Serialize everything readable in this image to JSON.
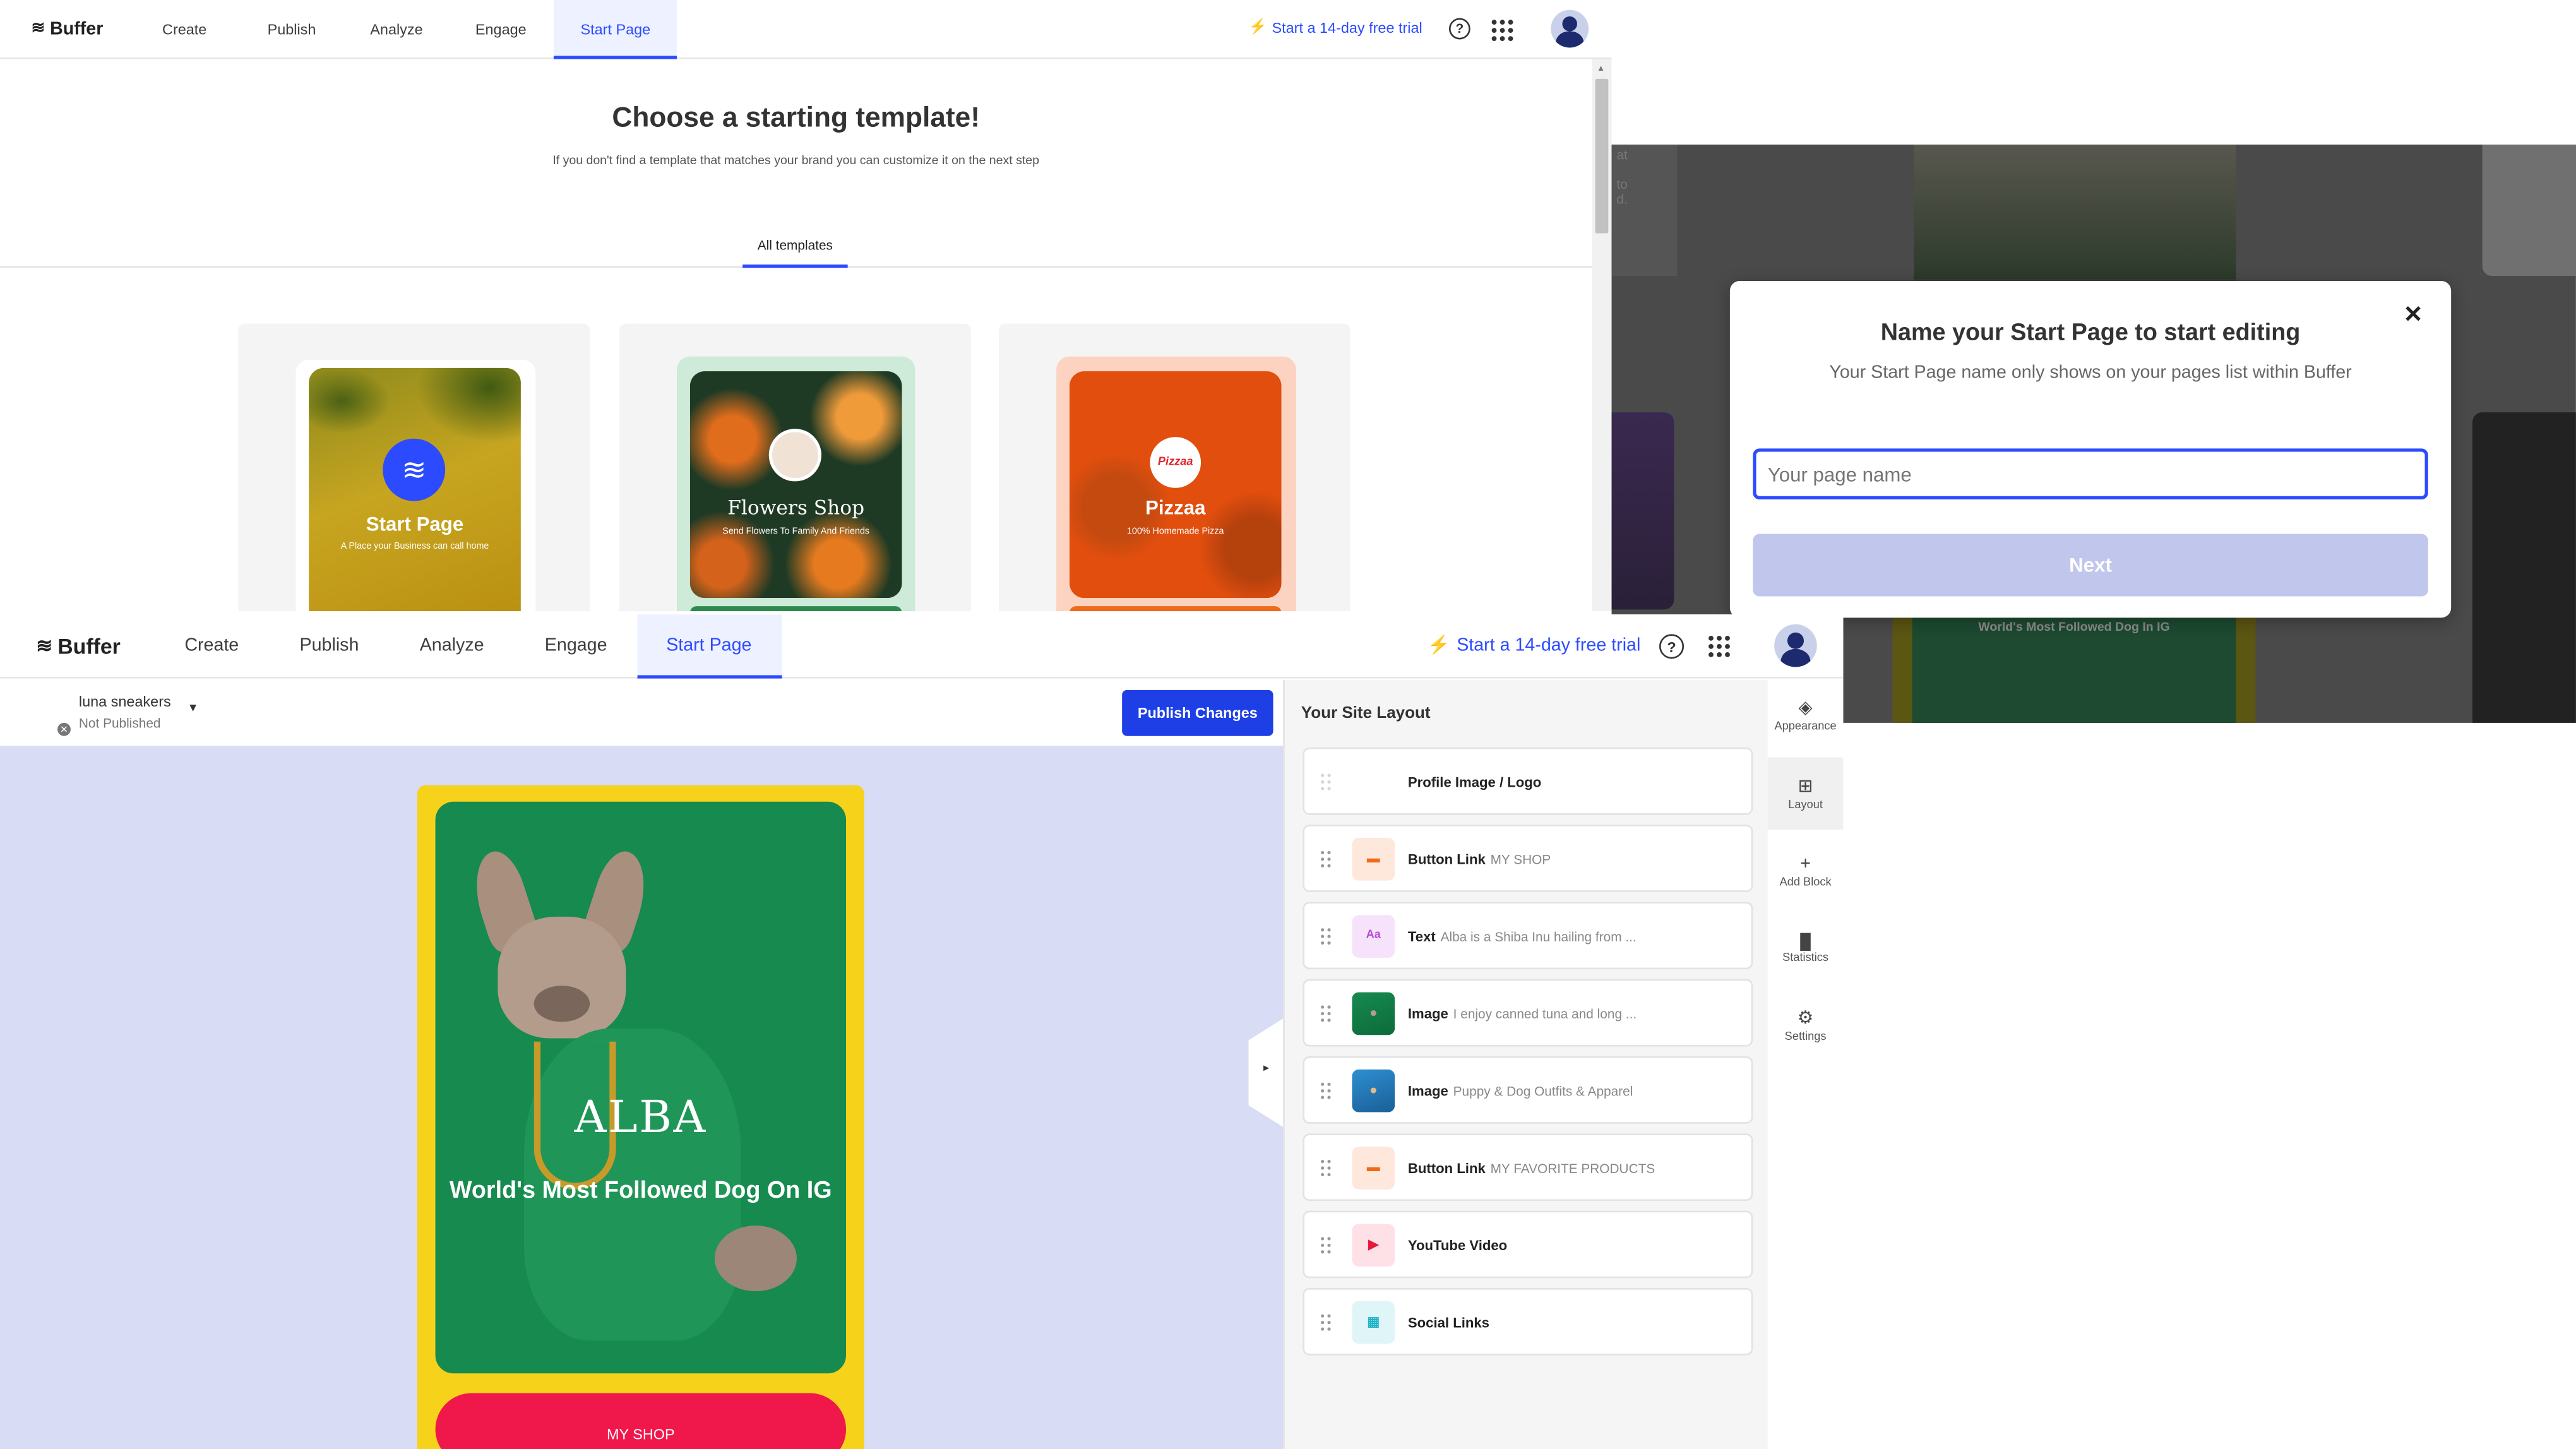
{
  "template_picker": {
    "nav": {
      "logo": "Buffer",
      "tabs": [
        "Create",
        "Publish",
        "Analyze",
        "Engage",
        "Start Page"
      ],
      "trial": "Start a 14-day free trial"
    },
    "title": "Choose a starting template!",
    "subtitle": "If you don't find a template that matches your brand you can customize it on the next step",
    "filter_tab": "All templates",
    "templates": [
      {
        "name": "Start Page",
        "tagline": "A Place your Business can call home"
      },
      {
        "name": "Flowers Shop",
        "tagline": "Send Flowers To Family And Friends"
      },
      {
        "name": "Pizzaa",
        "tagline": "100% Homemade Pizza",
        "badge": "Pizzaa"
      }
    ]
  },
  "editor": {
    "nav": {
      "logo": "Buffer",
      "tabs": [
        "Create",
        "Publish",
        "Analyze",
        "Engage",
        "Start Page"
      ],
      "trial": "Start a 14-day free trial"
    },
    "page_name": "luna sneakers",
    "page_status": "Not Published",
    "publish_button": "Publish Changes",
    "preview": {
      "name": "ALBA",
      "headline": "World's Most Followed Dog On IG",
      "button": "MY SHOP"
    },
    "layout_title": "Your Site Layout",
    "layout_items": [
      {
        "label": "Profile Image / Logo",
        "sub": ""
      },
      {
        "label": "Button Link",
        "sub": "MY SHOP"
      },
      {
        "label": "Text",
        "sub": "Alba is a Shiba Inu hailing from ..."
      },
      {
        "label": "Image",
        "sub": "I enjoy canned tuna and long ..."
      },
      {
        "label": "Image",
        "sub": "Puppy & Dog Outfits & Apparel"
      },
      {
        "label": "Button Link",
        "sub": "MY FAVORITE PRODUCTS"
      },
      {
        "label": "YouTube Video",
        "sub": ""
      },
      {
        "label": "Social Links",
        "sub": ""
      }
    ],
    "rail": [
      "Appearance",
      "Layout",
      "Add Block",
      "Statistics",
      "Settings"
    ]
  },
  "modal": {
    "title": "Name your Start Page to start editing",
    "subtitle": "Your Start Page name only shows on your pages list within Buffer",
    "placeholder": "Your page name",
    "next_button": "Next",
    "bg_caption": "World's Most Followed Dog In IG"
  },
  "colors": {
    "accent": "#2c4bff",
    "preview_bg": "#d8dcf4",
    "preview_frame": "#f7d21b",
    "preview_card": "#168a4f",
    "shop_button": "#f0174b"
  }
}
